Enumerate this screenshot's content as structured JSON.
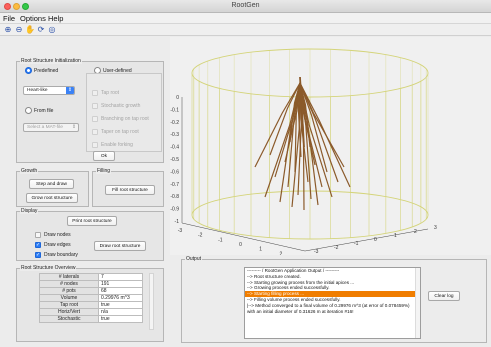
{
  "window": {
    "title": "RootGen"
  },
  "menu": {
    "items": [
      "File",
      "Options",
      "Help"
    ]
  },
  "toolbar": {
    "tools": [
      "zoom-in-icon",
      "zoom-out-icon",
      "pan-icon",
      "rotate-3d-icon",
      "reset-view-icon"
    ]
  },
  "init": {
    "legend": "Root Structure Initialization",
    "predefined_label": "Predefined",
    "user_defined_label": "User-defined",
    "predefined_value": "Heart-like",
    "from_file_label": "From file",
    "file_select_placeholder": "Select a MAT-file",
    "user_options": [
      "Tap root",
      "Stochastic growth",
      "Branching on tap root",
      "Taper on tap root",
      "Enable forking"
    ],
    "ok_label": "Ok"
  },
  "growth": {
    "legend": "Growth",
    "step_label": "Step and draw",
    "grow_label": "Grow root structure"
  },
  "filling": {
    "legend": "Filling",
    "fill_label": "Fill root structure"
  },
  "display": {
    "legend": "Display",
    "print_label": "Print root structure",
    "draw_nodes": "Draw nodes",
    "draw_edges": "Draw edges",
    "draw_boundary": "Draw boundary",
    "draw_root_label": "Draw root structure"
  },
  "overview": {
    "legend": "Root Structure Overview",
    "rows": [
      {
        "key": "# laterals",
        "value": "7"
      },
      {
        "key": "# nodes",
        "value": "191"
      },
      {
        "key": "# pots",
        "value": "68"
      },
      {
        "key": "Volume",
        "value": "0.29976 m^3"
      },
      {
        "key": "Tap root",
        "value": "true"
      },
      {
        "key": "Horiz/Vert",
        "value": "n/a"
      },
      {
        "key": "Stochastic",
        "value": "true"
      }
    ]
  },
  "plot": {
    "z_ticks": [
      "0",
      "-0.1",
      "-0.2",
      "-0.3",
      "-0.4",
      "-0.5",
      "-0.6",
      "-0.7",
      "-0.8",
      "-0.9",
      "-1"
    ],
    "x_ticks": [
      "-3",
      "-2",
      "-1",
      "0",
      "1",
      "2",
      "3"
    ],
    "y_ticks": [
      "-3",
      "-2",
      "-1",
      "0",
      "1",
      "2",
      "3"
    ],
    "colors": {
      "cylinder": "#d4d47a",
      "root": "#8b5a2b"
    }
  },
  "output": {
    "legend": "Output",
    "lines": [
      "--------- / RootGen Application Output / ---------",
      "--> Root structure created.",
      "--> Starting growing process from the initial apices ...",
      "--> Growing process ended successfully.",
      "--> Starting filling process ...",
      "--> Filling volume process ended successfully.",
      "|--> Method converged to a final volume of 0.29976 m^3 (at error of 0.078459%)",
      "       with an initial diameter of 0.31626 m at iteration #16!"
    ],
    "highlight_index": 4,
    "clear_label": "Clear log"
  }
}
